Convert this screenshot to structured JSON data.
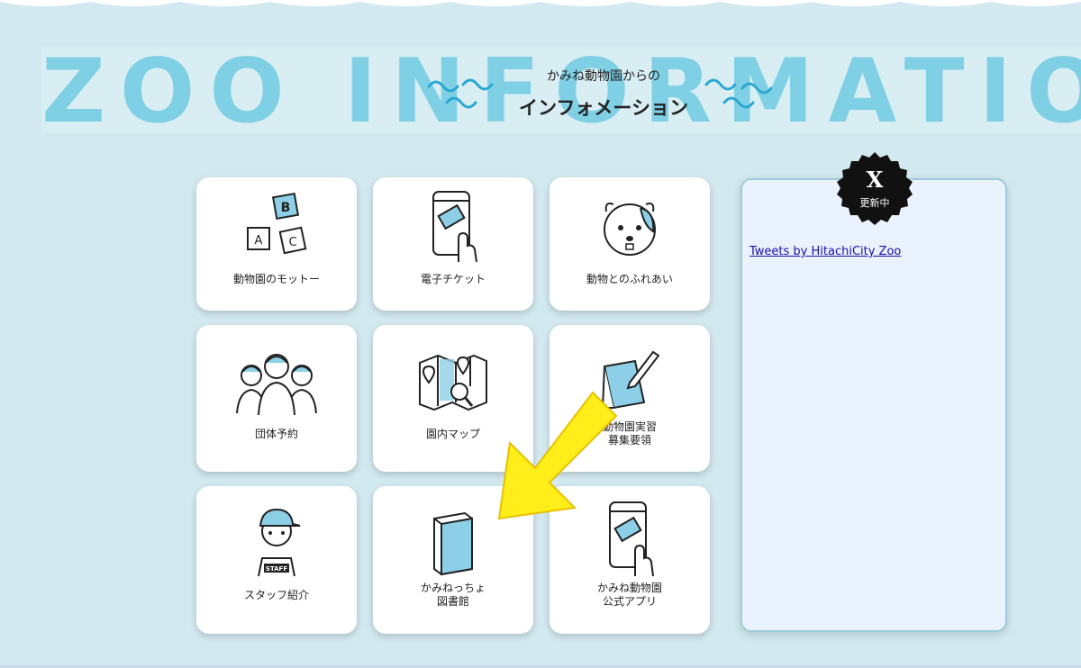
{
  "background_word": "ZOO INFORMATIO",
  "header": {
    "subtitle": "かみね動物園からの",
    "title": "インフォメーション"
  },
  "tiles": [
    {
      "label": "動物園のモットー",
      "icon": "abc-blocks-icon"
    },
    {
      "label": "電子チケット",
      "icon": "phone-ticket-icon"
    },
    {
      "label": "動物とのふれあい",
      "icon": "animal-face-icon"
    },
    {
      "label": "団体予約",
      "icon": "group-people-icon"
    },
    {
      "label": "園内マップ",
      "icon": "map-icon"
    },
    {
      "label": "動物園実習",
      "label2": "募集要領",
      "icon": "notebook-pen-icon"
    },
    {
      "label": "スタッフ紹介",
      "icon": "staff-icon"
    },
    {
      "label": "かみねっちょ",
      "label2": "図書館",
      "icon": "book-icon"
    },
    {
      "label": "かみね動物園",
      "label2": "公式アプリ",
      "icon": "phone-app-icon"
    }
  ],
  "x_panel": {
    "badge_glyph": "X",
    "badge_label": "更新中",
    "link_text": "Tweets by HitachiCity Zoo"
  },
  "colors": {
    "page_bg": "#d2e9ef",
    "accent_blue": "#7fd0e4",
    "icon_blue": "#8ccfe6",
    "arrow_yellow": "#ffee1a",
    "panel_bg": "#eaf3fd"
  }
}
